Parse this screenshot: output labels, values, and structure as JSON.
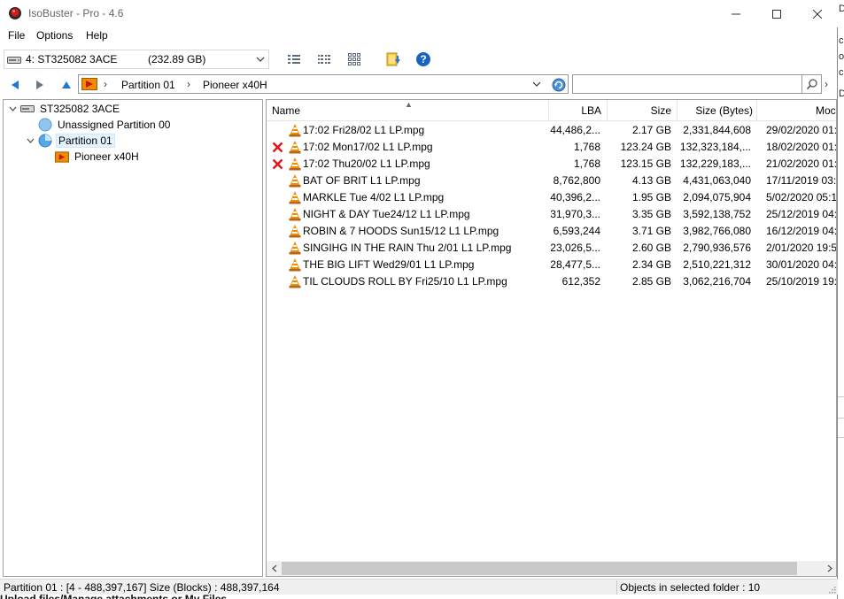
{
  "window": {
    "title": "IsoBuster - Pro - 4.6",
    "icon": "isobuster-app-icon"
  },
  "menu": [
    "File",
    "Options",
    "Help"
  ],
  "toolbar": {
    "device_name": "4: ST325082  3ACE",
    "device_size": "(232.89 GB)"
  },
  "address": {
    "crumbs": [
      "Partition 01",
      "Pioneer x40H"
    ],
    "search_placeholder": ""
  },
  "tree": {
    "root": "ST325082  3ACE",
    "items": [
      {
        "label": "Unassigned Partition 00",
        "icon": "partition-icon"
      },
      {
        "label": "Partition 01",
        "icon": "partition-icon",
        "selected": true
      },
      {
        "label": "Pioneer x40H",
        "icon": "folder-vr-icon"
      }
    ]
  },
  "list": {
    "columns": [
      "Name",
      "LBA",
      "Size",
      "Size (Bytes)",
      "Moc"
    ],
    "rows": [
      {
        "name": "17:02  Fri28/02   L1    LP.mpg",
        "lba": "44,486,2...",
        "size": "2.17 GB",
        "bytes": "2,331,844,608",
        "mod": "29/02/2020 01:0",
        "deleted": false
      },
      {
        "name": "17:02  Mon17/02   L1    LP.mpg",
        "lba": "1,768",
        "size": "123.24 GB",
        "bytes": "132,323,184,...",
        "mod": "18/02/2020 01:0",
        "deleted": true
      },
      {
        "name": "17:02  Thu20/02   L1    LP.mpg",
        "lba": "1,768",
        "size": "123.15 GB",
        "bytes": "132,229,183,...",
        "mod": "21/02/2020 01:0",
        "deleted": true
      },
      {
        "name": "BAT OF BRIT    L1    LP.mpg",
        "lba": "8,762,800",
        "size": "4.13 GB",
        "bytes": "4,431,063,040",
        "mod": "17/11/2019 03:1",
        "deleted": false
      },
      {
        "name": "MARKLE  Tue 4/02   L1    LP.mpg",
        "lba": "40,396,2...",
        "size": "1.95 GB",
        "bytes": "2,094,075,904",
        "mod": "5/02/2020 05:1",
        "deleted": false
      },
      {
        "name": "NIGHT & DAY  Tue24/12   L1    LP.mpg",
        "lba": "31,970,3...",
        "size": "3.35 GB",
        "bytes": "3,592,138,752",
        "mod": "25/12/2019 04:3",
        "deleted": false
      },
      {
        "name": "ROBIN & 7 HOODS  Sun15/12    L1    LP.mpg",
        "lba": "6,593,244",
        "size": "3.71 GB",
        "bytes": "3,982,766,080",
        "mod": "16/12/2019 04:1",
        "deleted": false
      },
      {
        "name": "SINGIHG IN THE RAIN    Thu 2/01    L1    LP.mpg",
        "lba": "23,026,5...",
        "size": "2.60 GB",
        "bytes": "2,790,936,576",
        "mod": "2/01/2020 19:5",
        "deleted": false
      },
      {
        "name": "THE BIG LIFT  Wed29/01   L1    LP.mpg",
        "lba": "28,477,5...",
        "size": "2.34 GB",
        "bytes": "2,510,221,312",
        "mod": "30/01/2020 04:2",
        "deleted": false
      },
      {
        "name": "TIL CLOUDS ROLL BY  Fri25/10   L1    LP.mpg",
        "lba": "612,352",
        "size": "2.85 GB",
        "bytes": "3,062,216,704",
        "mod": "25/10/2019 19:5",
        "deleted": false
      }
    ]
  },
  "status": {
    "left": "Partition 01 : [4 - 488,397,167]  Size (Blocks) : 488,397,164",
    "right": "Objects in selected folder : 10"
  },
  "background": {
    "bottom_text": "Upload files/Manage attachments   or   My Files",
    "right_fragments": [
      "D",
      "c",
      "o",
      "c",
      "D"
    ]
  },
  "colors": {
    "accent_blue": "#1e78d7",
    "delete_red": "#e0141e",
    "cone_orange": "#f08c00",
    "selection": "#e5f3ff"
  }
}
